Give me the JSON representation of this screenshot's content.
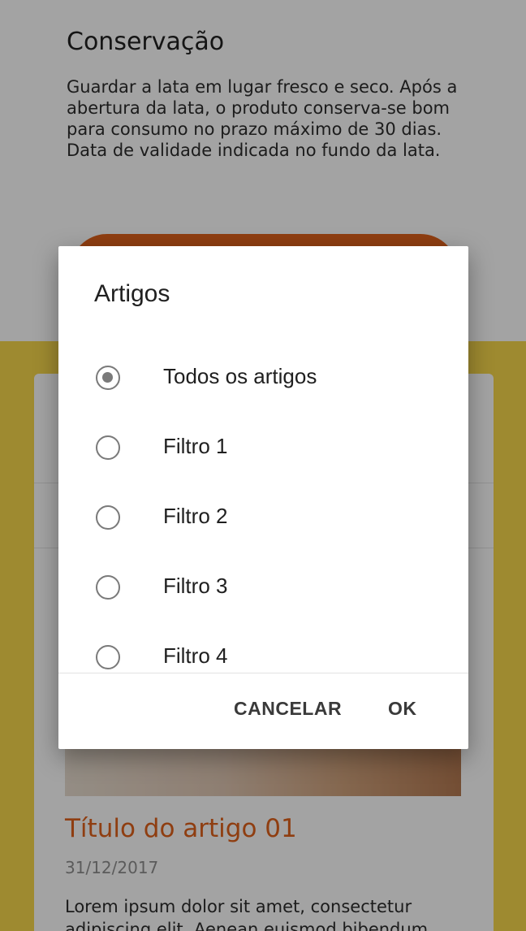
{
  "background": {
    "section_title": "Conservação",
    "section_text": "Guardar a lata em lugar fresco e seco. Após a abertura da lata, o produto conserva-se bom para consumo no prazo máximo de 30 dias. Data de validade indicada no fundo da lata.",
    "article": {
      "title": "Título do artigo 01",
      "date": "31/12/2017",
      "excerpt": "Lorem ipsum dolor sit amet, consectetur adipiscing elit. Aenean euismod bibendum"
    }
  },
  "dialog": {
    "title": "Artigos",
    "options": [
      {
        "label": "Todos os artigos",
        "selected": true
      },
      {
        "label": "Filtro 1",
        "selected": false
      },
      {
        "label": "Filtro 2",
        "selected": false
      },
      {
        "label": "Filtro 3",
        "selected": false
      },
      {
        "label": "Filtro 4",
        "selected": false
      }
    ],
    "cancel_label": "CANCELAR",
    "ok_label": "OK"
  },
  "colors": {
    "accent": "#e0621b",
    "yellow_background": "#f7d84b",
    "radio": "#7a7a7a"
  }
}
